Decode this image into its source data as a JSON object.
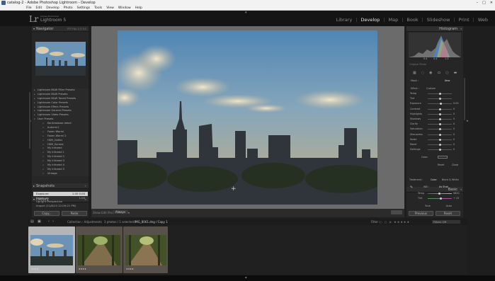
{
  "window": {
    "title": "catalog-2 - Adobe Photoshop Lightroom - Develop",
    "controls": [
      "–",
      "□",
      "✕"
    ]
  },
  "menu": [
    "File",
    "Edit",
    "Develop",
    "Photo",
    "Settings",
    "Tools",
    "View",
    "Window",
    "Help"
  ],
  "identity": {
    "logo": "Lr",
    "small": "Adobe Photoshop",
    "product": "Lightroom 5"
  },
  "modules": [
    {
      "label": "Library",
      "active": false
    },
    {
      "label": "Develop",
      "active": true
    },
    {
      "label": "Map",
      "active": false
    },
    {
      "label": "Book",
      "active": false
    },
    {
      "label": "Slideshow",
      "active": false
    },
    {
      "label": "Print",
      "active": false
    },
    {
      "label": "Web",
      "active": false
    }
  ],
  "left": {
    "navigator": {
      "title": "Navigator",
      "zoom": "FIT  FILL  1:1  3:1"
    },
    "presets": [
      {
        "label": "Lightroom B&W Filter Presets",
        "sub": false
      },
      {
        "label": "Lightroom B&W Presets",
        "sub": false
      },
      {
        "label": "Lightroom B&W Toned Presets",
        "sub": false
      },
      {
        "label": "Lightroom Color Presets",
        "sub": false
      },
      {
        "label": "Lightroom Effect Presets",
        "sub": false
      },
      {
        "label": "Lightroom General Presets",
        "sub": false
      },
      {
        "label": "Lightroom Video Presets",
        "sub": false
      },
      {
        "label": "User Presets",
        "sub": false
      },
      {
        "label": "Kontrastowe detali",
        "sub": true
      },
      {
        "label": "Autumn1",
        "sub": true
      },
      {
        "label": "Foxen Warmi",
        "sub": true
      },
      {
        "label": "Foxen Warmi 2",
        "sub": true
      },
      {
        "label": "HDR_Gothic",
        "sub": true
      },
      {
        "label": "HDR_Surreal",
        "sub": true
      },
      {
        "label": "My Infrared",
        "sub": true
      },
      {
        "label": "My Infrared 1",
        "sub": true
      },
      {
        "label": "My Infrared 2",
        "sub": true
      },
      {
        "label": "My Infrared 3",
        "sub": true
      },
      {
        "label": "My Infrared 4",
        "sub": true
      },
      {
        "label": "My Infrared 5",
        "sub": true
      },
      {
        "label": "Vintage",
        "sub": true
      }
    ],
    "snapshots": "Snapshots",
    "history": {
      "title": "History",
      "items": [
        {
          "label": "Exposure",
          "a": "1.00",
          "b": "0.00",
          "sel": true
        },
        {
          "label": "Exposure",
          "a": "1.00",
          "b": "",
          "sel": false
        },
        {
          "label": "Upright Perspective",
          "a": "",
          "b": "",
          "sel": false
        },
        {
          "label": "Import (11/8/13 12:09:21 PM)",
          "a": "",
          "b": "",
          "sel": false
        }
      ]
    },
    "copy_label": "Copy...",
    "paste_label": "Paste"
  },
  "toolbar": {
    "show_edit_pins": "Show Edit Pins :",
    "pins_value": "Always",
    "arrow": "▾"
  },
  "right": {
    "histogram": {
      "title": "Histogram",
      "readout": [
        "0.4",
        "0.4",
        "1.3"
      ]
    },
    "original_photo": "Original Photo",
    "basic": {
      "title": "Basic",
      "treatment": "Treatment :",
      "color": "Color",
      "bw": "Black & White",
      "wb": "WB :",
      "wb_value": "As Shot",
      "temp": "Temp",
      "temp_value": "5800",
      "tint": "Tint",
      "tint_value": "+ 10",
      "tone": "Tone",
      "auto": "Auto"
    },
    "mask_labels": [
      "Mask :",
      "New"
    ],
    "effect": {
      "label": "Effect :",
      "value": "Custom"
    },
    "sliders": [
      {
        "label": "Temp",
        "value": "",
        "pos": 0.5
      },
      {
        "label": "Tint",
        "value": "",
        "pos": 0.5
      },
      {
        "label": "Exposure",
        "value": "0.00",
        "pos": 0.55
      },
      {
        "label": "Contrast",
        "value": "0",
        "pos": 0.5
      },
      {
        "label": "Highlights",
        "value": "0",
        "pos": 0.5
      },
      {
        "label": "Shadows",
        "value": "0",
        "pos": 0.5
      },
      {
        "label": "Clarity",
        "value": "0",
        "pos": 0.5
      },
      {
        "label": "Saturation",
        "value": "0",
        "pos": 0.5
      },
      {
        "label": "Sharpness",
        "value": "0",
        "pos": 0.5
      },
      {
        "label": "Noise",
        "value": "0",
        "pos": 0.5
      },
      {
        "label": "Moiré",
        "value": "0",
        "pos": 0.5
      },
      {
        "label": "Defringe",
        "value": "0",
        "pos": 0.5
      }
    ],
    "color_label": "Color",
    "reset_mask": "Reset",
    "close_mask": "Close",
    "previous_label": "Previous",
    "reset_label": "Reset"
  },
  "filmstrip": {
    "info": "Collection : Adjustments",
    "count": "3 photos / 1 selected /",
    "file": "IMG_8061.dng / Copy 1",
    "filter_label": "Filter :",
    "filters_off": "Filters Off",
    "thumbs": [
      {
        "type": "city",
        "selected": true,
        "stars": "★★★★"
      },
      {
        "type": "forest",
        "selected": false,
        "stars": "★★★★"
      },
      {
        "type": "forest",
        "selected": false,
        "stars": "★★★★"
      }
    ]
  }
}
